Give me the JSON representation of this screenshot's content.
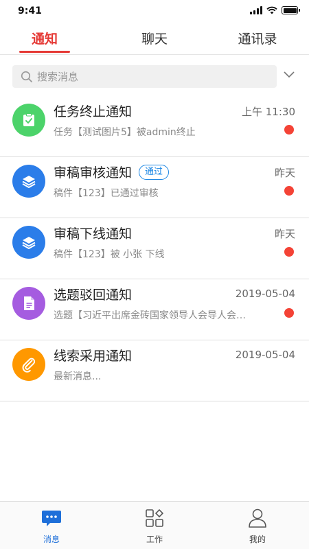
{
  "status_bar": {
    "time": "9:41"
  },
  "tabs": [
    {
      "label": "通知",
      "active": true
    },
    {
      "label": "聊天",
      "active": false
    },
    {
      "label": "通讯录",
      "active": false
    }
  ],
  "search": {
    "placeholder": "搜索消息",
    "value": ""
  },
  "notifications": [
    {
      "title": "任务终止通知",
      "subtitle": "任务【测试图片5】被admin终止",
      "time": "上午 11:30",
      "unread": true,
      "icon": "clipboard-check-icon",
      "color": "#4cd36a",
      "badge": ""
    },
    {
      "title": "审稿审核通知",
      "subtitle": "稿件【123】已通过审核",
      "time": "昨天",
      "unread": true,
      "icon": "layers-icon",
      "color": "#2b7de9",
      "badge": "通过"
    },
    {
      "title": "审稿下线通知",
      "subtitle": "稿件【123】被 小张 下线",
      "time": "昨天",
      "unread": true,
      "icon": "layers-icon",
      "color": "#2b7de9",
      "badge": ""
    },
    {
      "title": "选题驳回通知",
      "subtitle": "选题【习近平出席金砖国家领导人会导人会…",
      "time": "2019-05-04",
      "unread": true,
      "icon": "document-icon",
      "color": "#a55ce0",
      "badge": ""
    },
    {
      "title": "线索采用通知",
      "subtitle": "最新消息...",
      "time": "2019-05-04",
      "unread": false,
      "icon": "paperclip-icon",
      "color": "#ff9800",
      "badge": ""
    }
  ],
  "bottom_nav": [
    {
      "label": "消息",
      "icon": "message-icon",
      "active": true
    },
    {
      "label": "工作",
      "icon": "apps-icon",
      "active": false
    },
    {
      "label": "我的",
      "icon": "user-icon",
      "active": false
    }
  ],
  "colors": {
    "accent_red": "#e53935",
    "accent_blue": "#1e6fd9",
    "unread_dot": "#f44336"
  }
}
